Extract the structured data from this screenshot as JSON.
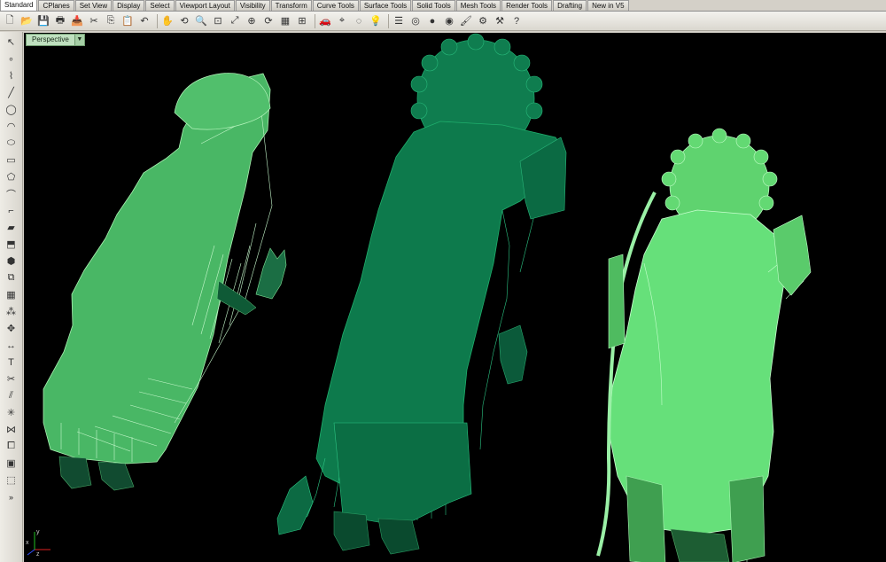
{
  "tabs": [
    {
      "label": "Standard",
      "active": true
    },
    {
      "label": "CPlanes"
    },
    {
      "label": "Set View"
    },
    {
      "label": "Display"
    },
    {
      "label": "Select"
    },
    {
      "label": "Viewport Layout"
    },
    {
      "label": "Visibility"
    },
    {
      "label": "Transform"
    },
    {
      "label": "Curve Tools"
    },
    {
      "label": "Surface Tools"
    },
    {
      "label": "Solid Tools"
    },
    {
      "label": "Mesh Tools"
    },
    {
      "label": "Render Tools"
    },
    {
      "label": "Drafting"
    },
    {
      "label": "New in V5"
    }
  ],
  "toolbar": {
    "icons": [
      "new-file",
      "open-file",
      "save-file",
      "print",
      "import",
      "cut",
      "copy",
      "paste",
      "undo",
      "pan",
      "rotate",
      "zoom-dynamic",
      "zoom-window",
      "zoom-extents",
      "zoom-selected",
      "rotate-view",
      "viewport-grid",
      "4-viewports",
      "car-render",
      "select",
      "wireframe",
      "light-bulb",
      "properties",
      "color-wheel",
      "shaded-sphere",
      "rendered-sphere",
      "paint",
      "gear",
      "options",
      "help"
    ]
  },
  "left_toolbar": {
    "icons": [
      "select-arrow",
      "point",
      "polyline",
      "line",
      "circle",
      "arc",
      "ellipse",
      "rectangle",
      "polygon",
      "curve-from-object",
      "fillet-curve",
      "surface",
      "extrude",
      "solid",
      "boolean",
      "mesh",
      "array",
      "transform",
      "dimension",
      "text",
      "trim",
      "split",
      "explode",
      "join",
      "group",
      "block",
      "cage"
    ],
    "more_label": "»"
  },
  "viewport": {
    "name": "Perspective",
    "dropdown_icon": "▼",
    "background": "#000000",
    "axes": {
      "x": "x",
      "y": "y",
      "z": "z"
    }
  },
  "colors": {
    "figure_left": "#4fbf6a",
    "figure_mid": "#0f7d4f",
    "figure_right": "#6fe07a",
    "wire": "#9cf0a8",
    "dark": "#0a3d22"
  }
}
